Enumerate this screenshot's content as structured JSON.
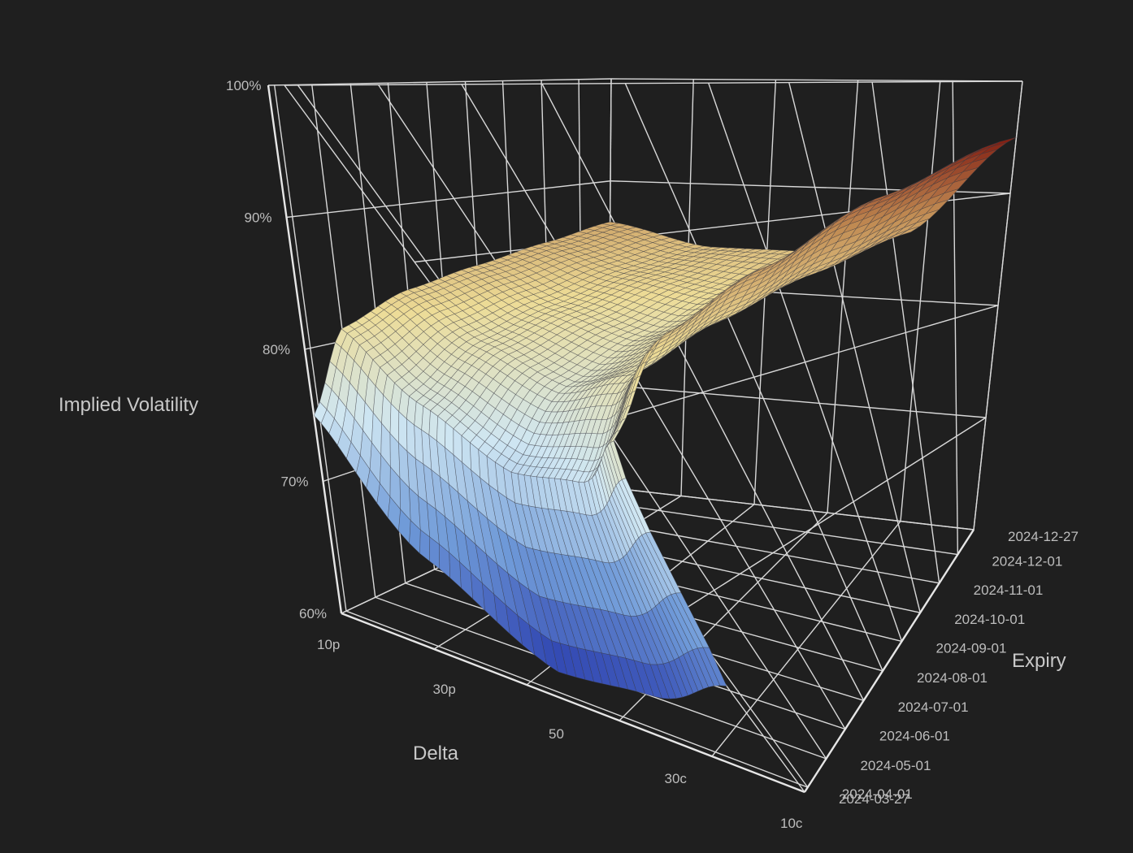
{
  "chart_data": {
    "type": "surface",
    "title": "",
    "xlabel": "Delta",
    "ylabel": "Expiry",
    "zlabel": "Implied Volatility",
    "x_ticks": [
      "10p",
      "30p",
      "50",
      "30c",
      "10c"
    ],
    "y_ticks": [
      "2024-03-27",
      "2024-04-01",
      "2024-05-01",
      "2024-06-01",
      "2024-07-01",
      "2024-08-01",
      "2024-09-01",
      "2024-10-01",
      "2024-11-01",
      "2024-12-01",
      "2024-12-27"
    ],
    "z_ticks": [
      "60%",
      "70%",
      "80%",
      "90%",
      "100%"
    ],
    "zlim": [
      60,
      100
    ],
    "delta_grid": [
      10,
      30,
      50,
      70,
      90
    ],
    "delta_grid_labels": [
      "10p",
      "30p",
      "50",
      "30c",
      "10c"
    ],
    "expiry_grid": [
      "2024-03-27",
      "2024-05-01",
      "2024-07-01",
      "2024-09-01",
      "2024-11-01",
      "2024-12-27"
    ],
    "iv_values": [
      [
        75,
        67,
        62,
        63,
        66
      ],
      [
        81,
        77,
        74,
        75,
        79
      ],
      [
        83,
        80,
        78,
        80,
        84
      ],
      [
        84,
        81.5,
        80,
        82,
        87
      ],
      [
        85,
        83,
        82,
        84,
        91
      ],
      [
        86,
        84,
        84,
        86,
        95
      ]
    ],
    "colorscale": [
      "#2b3fae",
      "#6f9ad8",
      "#cfe6f2",
      "#eddc97",
      "#c08a52",
      "#7f1a10"
    ],
    "background": "#1f1f1f"
  }
}
